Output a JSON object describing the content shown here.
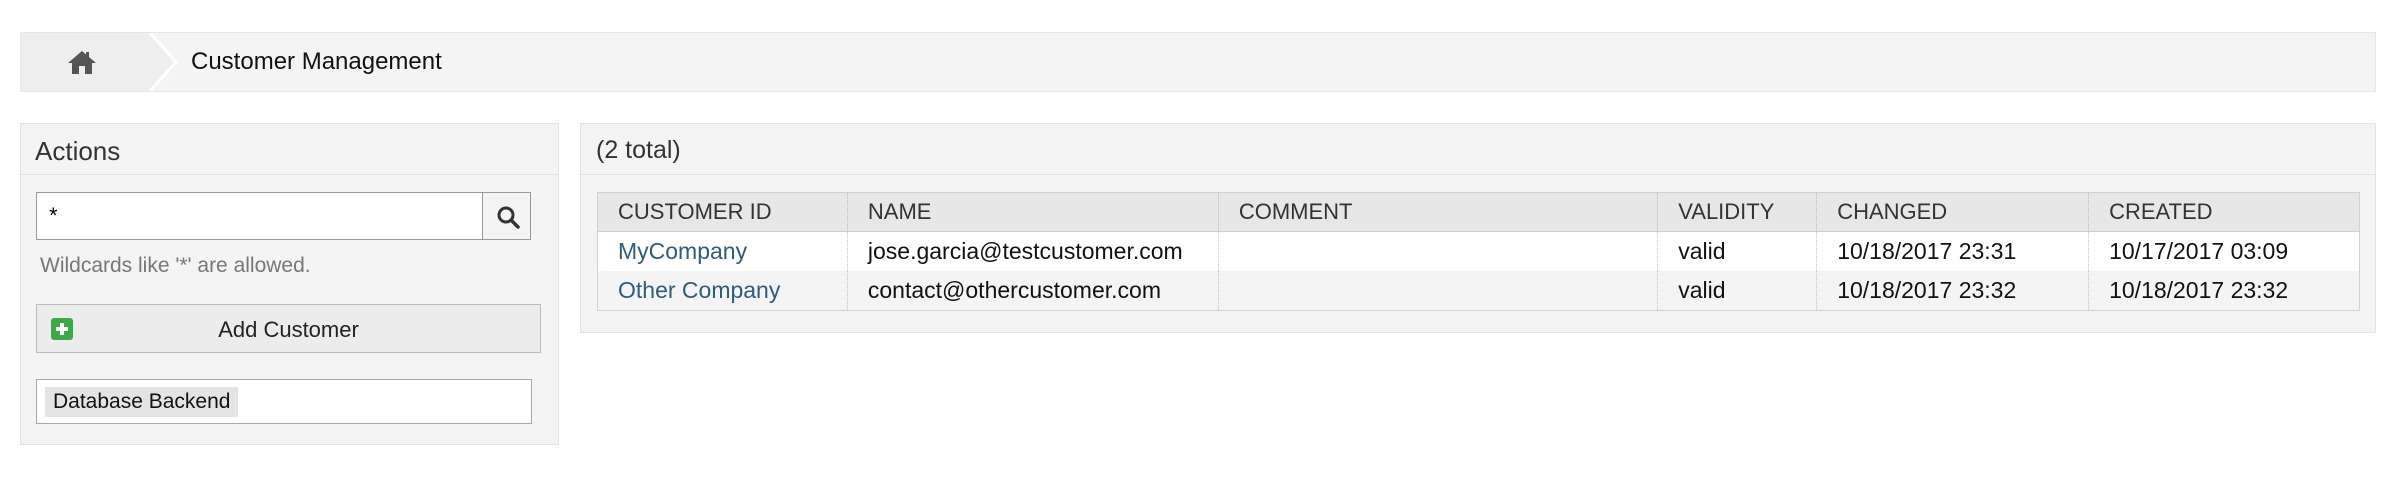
{
  "breadcrumb": {
    "home_icon": "home-icon",
    "title": "Customer Management"
  },
  "actions": {
    "title": "Actions",
    "search": {
      "value": "*",
      "button_icon": "search-icon"
    },
    "hint": "Wildcards like '*' are allowed.",
    "add_customer": {
      "label": "Add Customer",
      "icon": "plus-icon"
    },
    "backend_option": "Database Backend"
  },
  "results": {
    "title": "(2 total)",
    "columns": [
      "CUSTOMER ID",
      "NAME",
      "COMMENT",
      "VALIDITY",
      "CHANGED",
      "CREATED"
    ],
    "rows": [
      {
        "customer_id": "MyCompany",
        "name": "jose.garcia@testcustomer.com",
        "comment": "",
        "validity": "valid",
        "changed": "10/18/2017 23:31",
        "created": "10/17/2017 03:09"
      },
      {
        "customer_id": "Other Company",
        "name": "contact@othercustomer.com",
        "comment": "",
        "validity": "valid",
        "changed": "10/18/2017 23:32",
        "created": "10/18/2017 23:32"
      }
    ]
  },
  "colors": {
    "link": "#2f5c78",
    "add_icon": "#3bab45",
    "panel_bg": "#f4f4f4"
  }
}
